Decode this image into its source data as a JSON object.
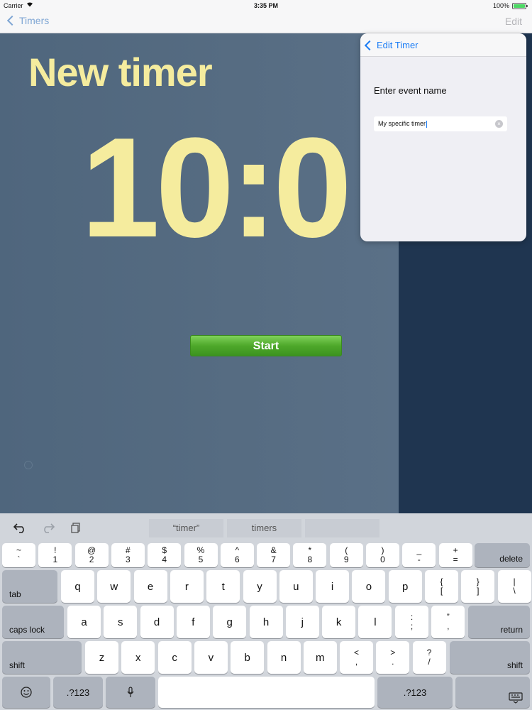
{
  "status_bar": {
    "carrier": "Carrier",
    "wifi_icon": "wifi-icon",
    "time": "3:35 PM",
    "battery_pct": "100%",
    "battery_level": 1.0
  },
  "nav_bar": {
    "back_label": "Timers",
    "edit_label": "Edit"
  },
  "timer": {
    "title": "New timer",
    "value": "10:0",
    "start_label": "Start"
  },
  "popover": {
    "back_label": "Edit Timer",
    "field_label": "Enter event name",
    "input_value": "My specific timer"
  },
  "keyboard": {
    "toolbar": {
      "undo_icon": "undo-icon",
      "redo_icon": "redo-icon",
      "paste_icon": "paste-icon",
      "suggestions": [
        "“timer”",
        "timers",
        ""
      ]
    },
    "number_row": [
      {
        "top": "~",
        "bottom": "`"
      },
      {
        "top": "!",
        "bottom": "1"
      },
      {
        "top": "@",
        "bottom": "2"
      },
      {
        "top": "#",
        "bottom": "3"
      },
      {
        "top": "$",
        "bottom": "4"
      },
      {
        "top": "%",
        "bottom": "5"
      },
      {
        "top": "^",
        "bottom": "6"
      },
      {
        "top": "&",
        "bottom": "7"
      },
      {
        "top": "*",
        "bottom": "8"
      },
      {
        "top": "(",
        "bottom": "9"
      },
      {
        "top": ")",
        "bottom": "0"
      },
      {
        "top": "_",
        "bottom": "-"
      },
      {
        "top": "+",
        "bottom": "="
      }
    ],
    "delete_label": "delete",
    "tab_label": "tab",
    "row_qwerty": [
      "q",
      "w",
      "e",
      "r",
      "t",
      "y",
      "u",
      "i",
      "o",
      "p"
    ],
    "row_qwerty_sym": [
      {
        "top": "{",
        "bottom": "["
      },
      {
        "top": "}",
        "bottom": "]"
      },
      {
        "top": "|",
        "bottom": "\\"
      }
    ],
    "caps_label": "caps lock",
    "row_asdf": [
      "a",
      "s",
      "d",
      "f",
      "g",
      "h",
      "j",
      "k",
      "l"
    ],
    "row_asdf_sym": [
      {
        "top": ":",
        "bottom": ";"
      },
      {
        "top": "”",
        "bottom": ","
      }
    ],
    "return_label": "return",
    "shift_label": "shift",
    "row_zxcv": [
      "z",
      "x",
      "c",
      "v",
      "b",
      "n",
      "m"
    ],
    "row_zxcv_sym": [
      {
        "top": "<",
        "bottom": ","
      },
      {
        "top": ">",
        "bottom": "."
      },
      {
        "top": "?",
        "bottom": "/"
      }
    ],
    "emoji_icon": "emoji-icon",
    "numbers_label": ".?123",
    "mic_icon": "microphone-icon",
    "hide_keyboard_icon": "keyboard-dismiss-icon"
  }
}
